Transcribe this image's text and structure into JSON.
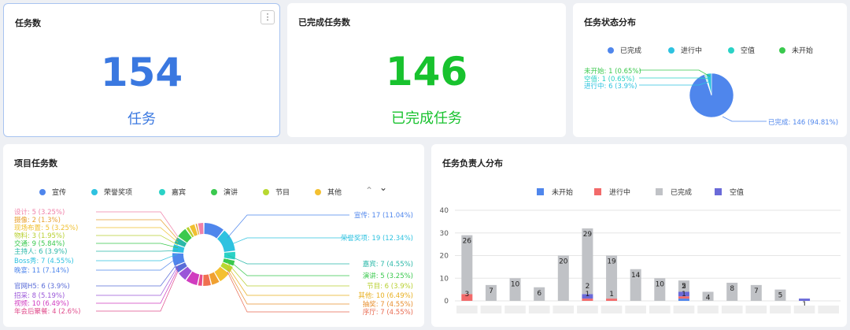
{
  "cards": {
    "total": {
      "title": "任务数",
      "value": "154",
      "label": "任务",
      "color": "#3a78e0",
      "menu_glyph": "⋮"
    },
    "done": {
      "title": "已完成任务数",
      "value": "146",
      "label": "已完成任务",
      "color": "#18c22e"
    }
  },
  "status_chart": {
    "title": "任务状态分布",
    "legend": [
      {
        "name": "已完成",
        "color": "#4f86ec"
      },
      {
        "name": "进行中",
        "color": "#2ec2e0"
      },
      {
        "name": "空值",
        "color": "#2ad2c6"
      },
      {
        "name": "未开始",
        "color": "#3ac94e"
      }
    ],
    "labels": {
      "not_started": "未开始: 1 (0.65%)",
      "empty": "空值: 1 (0.65%)",
      "in_progress": "进行中: 6 (3.9%)",
      "done": "已完成: 146 (94.81%)"
    }
  },
  "project_chart": {
    "title": "项目任务数",
    "legend": [
      {
        "name": "宣传",
        "color": "#4f86ec"
      },
      {
        "name": "荣誉奖项",
        "color": "#2ec2e0"
      },
      {
        "name": "嘉宾",
        "color": "#2ad2c6"
      },
      {
        "name": "演讲",
        "color": "#3ac94e"
      },
      {
        "name": "节目",
        "color": "#b8d830"
      },
      {
        "name": "其他",
        "color": "#f4c030"
      }
    ],
    "pager_up": "⌃",
    "pager_down": "⌄",
    "left_labels": [
      {
        "text": "设计: 5 (3.25%)",
        "color": "#f080a8"
      },
      {
        "text": "摄像: 2 (1.3%)",
        "color": "#e8a030"
      },
      {
        "text": "现场布置: 5 (3.25%)",
        "color": "#f0c030"
      },
      {
        "text": "物料: 3 (1.95%)",
        "color": "#b8d030"
      },
      {
        "text": "交通: 9 (5.84%)",
        "color": "#3ac94e"
      },
      {
        "text": "主持人: 6 (3.9%)",
        "color": "#2ab8a8"
      },
      {
        "text": "Boss秀: 7 (4.55%)",
        "color": "#2ec2e0"
      },
      {
        "text": "晚宴: 11 (7.14%)",
        "color": "#4f86ec"
      },
      {
        "text": "官网H5: 6 (3.9%)",
        "color": "#5a6cd8"
      },
      {
        "text": "招采: 8 (5.19%)",
        "color": "#9a56d8"
      },
      {
        "text": "视频: 10 (6.49%)",
        "color": "#d03cc0"
      },
      {
        "text": "年会后聚餐: 4 (2.6%)",
        "color": "#e04c8c"
      }
    ],
    "right_labels": [
      {
        "text": "宣传: 17 (11.04%)",
        "color": "#4f86ec"
      },
      {
        "text": "荣誉奖项: 19 (12.34%)",
        "color": "#2ec2e0"
      },
      {
        "text": "嘉宾: 7 (4.55%)",
        "color": "#2ab8a8"
      },
      {
        "text": "演讲: 5 (3.25%)",
        "color": "#3ac94e"
      },
      {
        "text": "节目: 6 (3.9%)",
        "color": "#b8d030"
      },
      {
        "text": "其他: 10 (6.49%)",
        "color": "#e8b020"
      },
      {
        "text": "抽奖: 7 (4.55%)",
        "color": "#e89030"
      },
      {
        "text": "序厅: 7 (4.55%)",
        "color": "#e86a50"
      }
    ]
  },
  "assignee_chart": {
    "title": "任务负责人分布",
    "legend": [
      {
        "name": "未开始",
        "color": "#4f86ec"
      },
      {
        "name": "进行中",
        "color": "#f26a6a"
      },
      {
        "name": "已完成",
        "color": "#c0c2c6"
      },
      {
        "name": "空值",
        "color": "#6a6ad8"
      }
    ],
    "y_ticks": [
      "40",
      "30",
      "20",
      "10",
      "0"
    ]
  },
  "chart_data": [
    {
      "type": "pie",
      "title": "任务状态分布",
      "slices": [
        {
          "name": "已完成",
          "value": 146,
          "percent": 94.81,
          "color": "#4f86ec"
        },
        {
          "name": "进行中",
          "value": 6,
          "percent": 3.9,
          "color": "#2ec2e0"
        },
        {
          "name": "空值",
          "value": 1,
          "percent": 0.65,
          "color": "#2ad2c6"
        },
        {
          "name": "未开始",
          "value": 1,
          "percent": 0.65,
          "color": "#3ac94e"
        }
      ]
    },
    {
      "type": "pie",
      "variant": "donut",
      "title": "项目任务数",
      "slices": [
        {
          "name": "宣传",
          "value": 17,
          "color": "#4f86ec"
        },
        {
          "name": "荣誉奖项",
          "value": 19,
          "color": "#2ec2e0"
        },
        {
          "name": "嘉宾",
          "value": 7,
          "color": "#2ad2c6"
        },
        {
          "name": "演讲",
          "value": 5,
          "color": "#3ac94e"
        },
        {
          "name": "节目",
          "value": 6,
          "color": "#b8d830"
        },
        {
          "name": "其他",
          "value": 10,
          "color": "#f4c030"
        },
        {
          "name": "抽奖",
          "value": 7,
          "color": "#f0a030"
        },
        {
          "name": "序厅",
          "value": 7,
          "color": "#f07050"
        },
        {
          "name": "年会后聚餐",
          "value": 4,
          "color": "#e84c8c"
        },
        {
          "name": "视频",
          "value": 10,
          "color": "#d03cc0"
        },
        {
          "name": "招采",
          "value": 8,
          "color": "#9a56d8"
        },
        {
          "name": "官网H5",
          "value": 6,
          "color": "#5a6cd8"
        },
        {
          "name": "晚宴",
          "value": 11,
          "color": "#4f86ec"
        },
        {
          "name": "Boss秀",
          "value": 7,
          "color": "#2ec2e0"
        },
        {
          "name": "主持人",
          "value": 6,
          "color": "#2ab8a8"
        },
        {
          "name": "交通",
          "value": 9,
          "color": "#3ac94e"
        },
        {
          "name": "物料",
          "value": 3,
          "color": "#b8d030"
        },
        {
          "name": "现场布置",
          "value": 5,
          "color": "#f0c030"
        },
        {
          "name": "摄像",
          "value": 2,
          "color": "#e8a030"
        },
        {
          "name": "设计",
          "value": 5,
          "color": "#f080a8"
        }
      ]
    },
    {
      "type": "bar",
      "stacked": true,
      "title": "任务负责人分布",
      "ylim": [
        0,
        40
      ],
      "categories": [
        "",
        "",
        "",
        "",
        "",
        "",
        "",
        "",
        "",
        "",
        "",
        "",
        "",
        "",
        "",
        ""
      ],
      "series": [
        {
          "name": "未开始",
          "color": "#4f86ec",
          "values": [
            0,
            0,
            0,
            0,
            0,
            0,
            0,
            0,
            0,
            1,
            0,
            0,
            0,
            0,
            0,
            0
          ]
        },
        {
          "name": "进行中",
          "color": "#f26a6a",
          "values": [
            3,
            0,
            0,
            0,
            0,
            1,
            1,
            0,
            0,
            1,
            0,
            0,
            0,
            0,
            0,
            0
          ]
        },
        {
          "name": "已完成",
          "color": "#c0c2c6",
          "values": [
            26,
            7,
            10,
            6,
            20,
            29,
            19,
            14,
            10,
            5,
            4,
            8,
            7,
            5,
            0,
            0
          ]
        },
        {
          "name": "空值",
          "color": "#6a6ad8",
          "values": [
            0,
            0,
            0,
            0,
            0,
            2,
            0,
            0,
            0,
            2,
            0,
            0,
            0,
            0,
            1,
            0
          ]
        }
      ],
      "data_labels": [
        [
          "3",
          "26"
        ],
        [
          "7"
        ],
        [
          "10"
        ],
        [
          "6"
        ],
        [
          "20"
        ],
        [
          "1",
          "2",
          "29"
        ],
        [
          "1",
          "19"
        ],
        [
          "14"
        ],
        [
          "10"
        ],
        [
          "1",
          "2",
          "5"
        ],
        [
          "4"
        ],
        [
          "8"
        ],
        [
          "7"
        ],
        [
          "5"
        ],
        [
          "1"
        ],
        []
      ]
    }
  ]
}
